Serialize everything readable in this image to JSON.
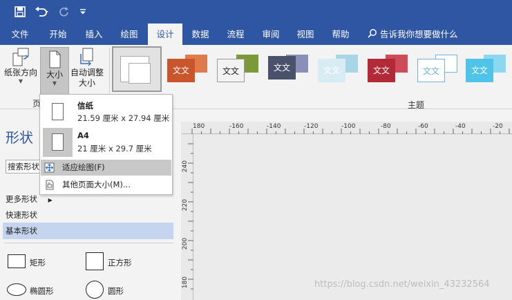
{
  "qat": {
    "save_icon": "save-icon",
    "undo_icon": "undo-icon",
    "redo_icon": "redo-icon",
    "customize_icon": "customize-icon"
  },
  "tabs": [
    {
      "label": "文件"
    },
    {
      "label": "开始"
    },
    {
      "label": "插入"
    },
    {
      "label": "绘图"
    },
    {
      "label": "设计",
      "active": true
    },
    {
      "label": "数据"
    },
    {
      "label": "流程"
    },
    {
      "label": "审阅"
    },
    {
      "label": "视图"
    },
    {
      "label": "帮助"
    }
  ],
  "tell_me": "告诉我你想要做什么",
  "ribbon": {
    "orientation_label": "纸张方向",
    "size_label": "大小",
    "autosize_label_1": "自动调整",
    "autosize_label_2": "大小",
    "page_setup_group": "页",
    "themes_group": "主题",
    "theme_text": "文文"
  },
  "pane": {
    "title": "形状",
    "search_placeholder": "搜索形状",
    "more_shapes": "更多形状",
    "quick_shapes": "快速形状",
    "basic_shapes": "基本形状",
    "shapes": [
      {
        "label": "矩形"
      },
      {
        "label": "正方形"
      },
      {
        "label": "椭圆形"
      },
      {
        "label": "圆形"
      }
    ]
  },
  "ruler": {
    "h_labels": [
      "180",
      "-160",
      "-140",
      "-120",
      "-100",
      "-80",
      "-60",
      "-40",
      "-20"
    ],
    "v_labels": [
      "240",
      "220",
      "200",
      "180"
    ]
  },
  "dropdown": {
    "papers": [
      {
        "name": "信纸",
        "dim": "21.59 厘米 x 27.94 厘米"
      },
      {
        "name": "A4",
        "dim": "21 厘米 x 29.7 厘米"
      }
    ],
    "fit_drawing": "适应绘图(F)",
    "more_sizes": "其他页面大小(M)..."
  },
  "watermark": "https://blog.csdn.net/weixin_43232564",
  "colors": {
    "title_bar": "#2f56a3",
    "selection": "#c5d5ef",
    "theme_1": "#c8552b",
    "theme_2": "#7a9a3a",
    "theme_3": "#48526b",
    "theme_4": "#7fb9cf",
    "theme_5": "#b22a38",
    "theme_6": "#6fb3d8",
    "theme_7": "#4fc3e8"
  }
}
